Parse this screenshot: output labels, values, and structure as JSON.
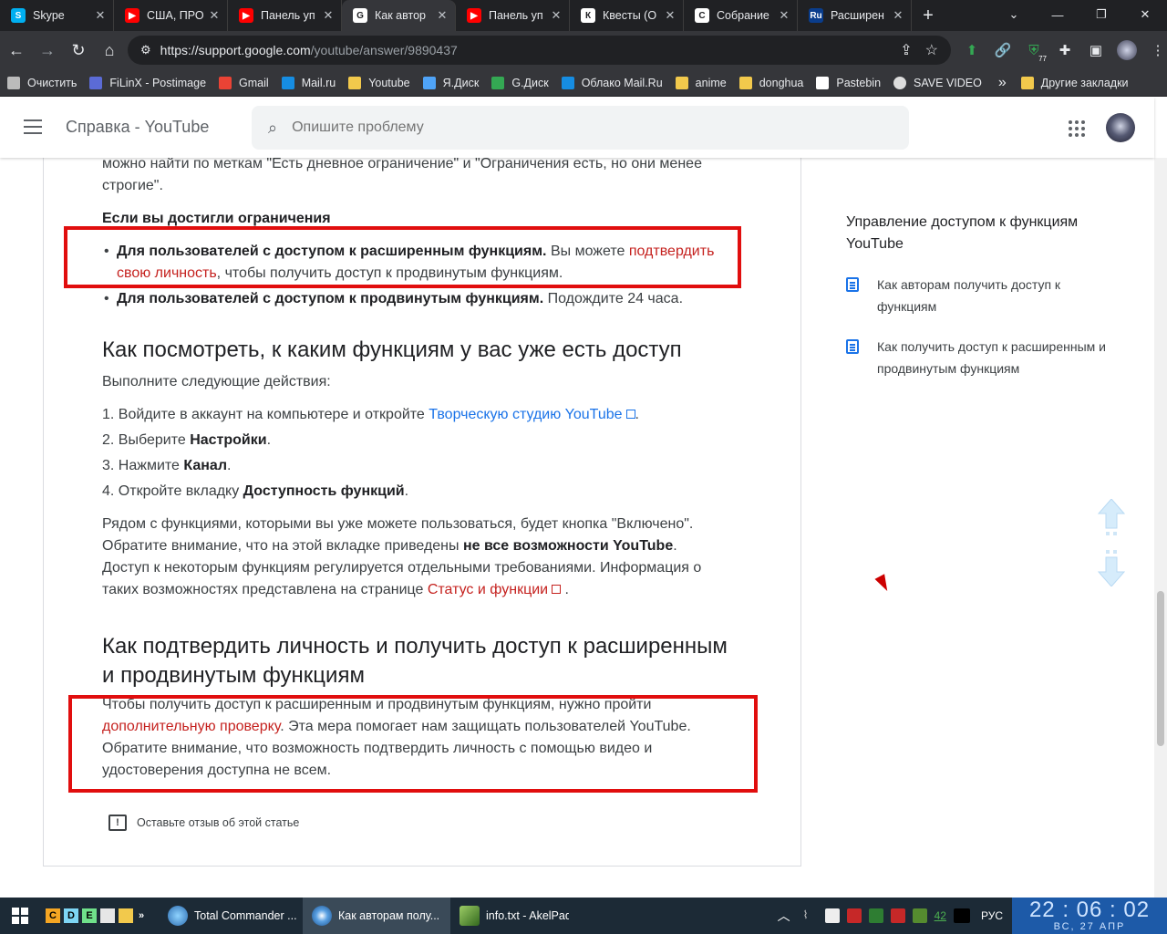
{
  "browser": {
    "tabs": [
      {
        "title": "Skype",
        "icon": "skype-icon",
        "color": "#00aff0",
        "glyph": "S"
      },
      {
        "title": "США, ПРО",
        "icon": "youtube-icon",
        "color": "#ff0000",
        "glyph": "▶"
      },
      {
        "title": "Панель уп",
        "icon": "youtube-icon",
        "color": "#ff0000",
        "glyph": "▶"
      },
      {
        "title": "Как автор",
        "icon": "google-icon",
        "color": "#ffffff",
        "glyph": "G",
        "active": true
      },
      {
        "title": "Панель уп",
        "icon": "youtube-icon",
        "color": "#ff0000",
        "glyph": "▶"
      },
      {
        "title": "Квесты (О",
        "icon": "site-icon",
        "color": "#ffffff",
        "glyph": "К"
      },
      {
        "title": "Собрание",
        "icon": "site-icon",
        "color": "#ffffff",
        "glyph": "С"
      },
      {
        "title": "Расширен",
        "icon": "ru-icon",
        "color": "#0a3d8c",
        "glyph": "Ru"
      }
    ],
    "url_host": "https://support.google.com",
    "url_path": "/youtube/answer/9890437",
    "extension_badge": "77",
    "bookmarks": [
      {
        "label": "Очистить",
        "icon": "gear-icon"
      },
      {
        "label": "FiLinX - Postimage",
        "icon": "postimage-icon"
      },
      {
        "label": "Gmail",
        "icon": "gmail-icon"
      },
      {
        "label": "Mail.ru",
        "icon": "mailru-icon"
      },
      {
        "label": "Youtube",
        "icon": "folder-icon"
      },
      {
        "label": "Я.Диск",
        "icon": "yadisk-icon"
      },
      {
        "label": "G.Диск",
        "icon": "gdrive-icon"
      },
      {
        "label": "Облако Mail.Ru",
        "icon": "cloud-icon"
      },
      {
        "label": "anime",
        "icon": "folder-icon"
      },
      {
        "label": "donghua",
        "icon": "folder-icon"
      },
      {
        "label": "Pastebin",
        "icon": "pastebin-icon"
      },
      {
        "label": "SAVE VIDEO",
        "icon": "globe-icon"
      }
    ],
    "bookmarks_more": "»",
    "other_bookmarks": "Другие закладки"
  },
  "header": {
    "title": "Справка - YouTube",
    "search_placeholder": "Опишите проблему"
  },
  "article": {
    "intro_fragment": "можно найти по меткам \"Есть дневное ограничение\" и \"Ограничения есть, но они менее строгие\".",
    "limits_heading": "Если вы достигли ограничения",
    "limit_items": [
      {
        "bold": "Для пользователей с доступом к расширенным функциям.",
        "pre": " Вы можете ",
        "link": "подтвердить свою личность",
        "post": ", чтобы получить доступ к продвинутым функциям."
      },
      {
        "bold": "Для пользователей с доступом к продвинутым функциям.",
        "pre": " Подождите 24 часа.",
        "link": "",
        "post": ""
      }
    ],
    "section1_title": "Как посмотреть, к каким функциям у вас уже есть доступ",
    "section1_intro": "Выполните следующие действия:",
    "steps": [
      {
        "num": "1.",
        "pre": "Войдите в аккаунт на компьютере и откройте ",
        "link": "Творческую студию YouTube",
        "bold": "",
        "post": "."
      },
      {
        "num": "2.",
        "pre": "Выберите ",
        "link": "",
        "bold": "Настройки",
        "post": "."
      },
      {
        "num": "3.",
        "pre": "Нажмите ",
        "link": "",
        "bold": "Канал",
        "post": "."
      },
      {
        "num": "4.",
        "pre": "Откройте вкладку ",
        "link": "",
        "bold": "Доступность функций",
        "post": "."
      }
    ],
    "para1": {
      "a": "Рядом с функциями, которыми вы уже можете пользоваться, будет кнопка \"Включено\". Обратите внимание, что на этой вкладке приведены ",
      "bold": "не все возможности YouTube",
      "b": ". Доступ к некоторым функциям регулируется отдельными требованиями. Информация о таких возможностях представлена на странице ",
      "link": "Статус и функции",
      "c": " ."
    },
    "section2_title": "Как подтвердить личность и получить доступ к расширенным и продвинутым функциям",
    "para2": {
      "a": "Чтобы получить доступ к расширенным и продвинутым функциям, нужно пройти ",
      "link": "дополнительную проверку",
      "b": ". Эта мера помогает нам защищать пользователей YouTube. Обратите внимание, что возможность подтвердить личность с помощью видео и удостоверения доступна не всем."
    },
    "feedback_label": "Оставьте отзыв об этой статье"
  },
  "sidebar": {
    "heading": "Управление доступом к функциям YouTube",
    "items": [
      {
        "label": "Как авторам получить доступ к функциям"
      },
      {
        "label": "Как получить доступ к расширенным и продвинутым функциям"
      }
    ]
  },
  "taskbar": {
    "quick_launch": [
      "C",
      "D",
      "E"
    ],
    "tasks": [
      {
        "label": "Total Commander ...",
        "icon": "totalcmd-icon"
      },
      {
        "label": "Как авторам полу...",
        "icon": "chrome-icon",
        "active": true
      },
      {
        "label": "info.txt - AkelPad",
        "icon": "akelpad-icon"
      }
    ],
    "tray_count": "42",
    "language": "РУС",
    "time": "22 : 06 : 02",
    "date": "ВС, 27  АПР"
  },
  "colors": {
    "highlight_box": "#e10e0e",
    "link_red": "#c5221f",
    "link_blue": "#1a73e8",
    "chrome_dark": "#35363a"
  }
}
